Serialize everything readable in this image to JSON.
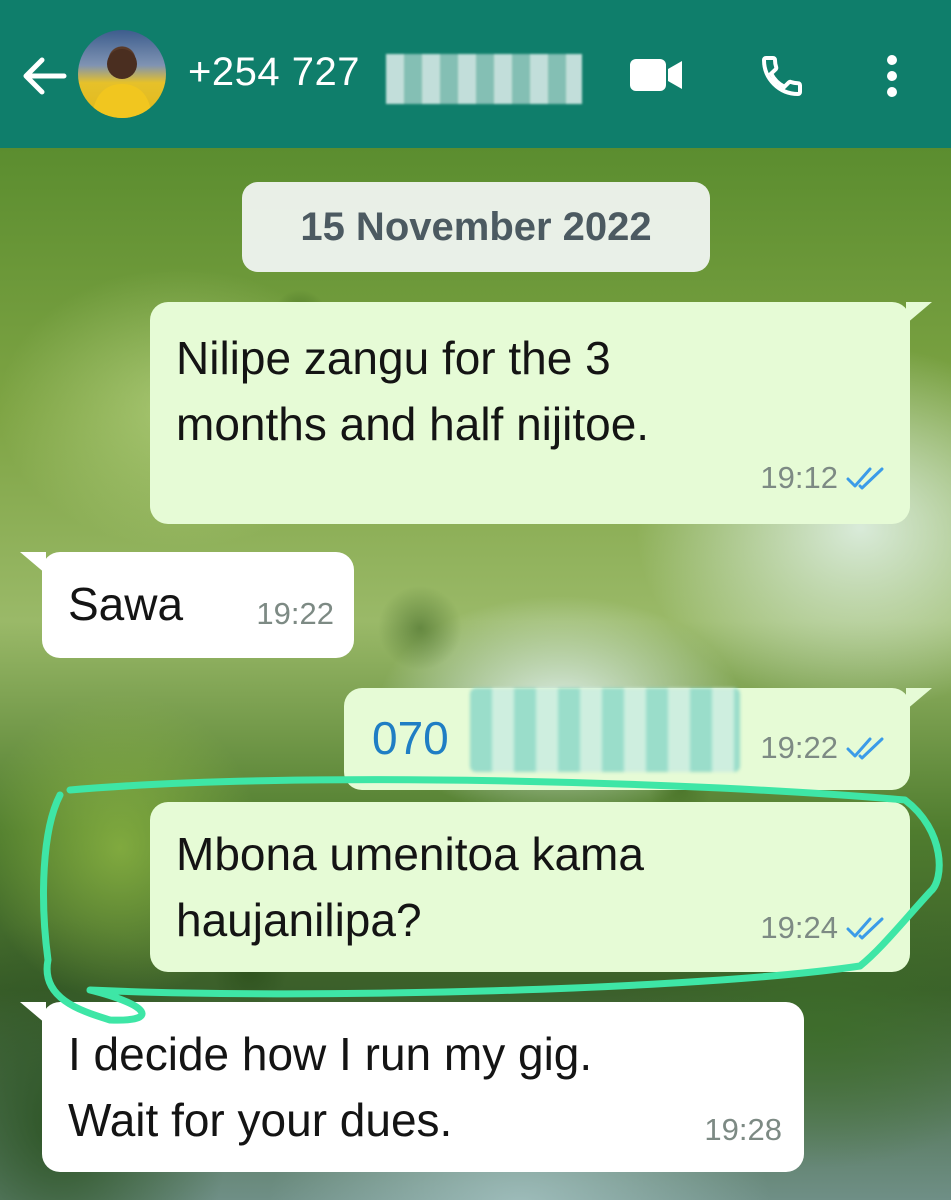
{
  "header": {
    "contact_name": "+254 727",
    "back_icon": "arrow-left-icon",
    "avatar_icon": "avatar",
    "video_icon": "video-camera-icon",
    "call_icon": "phone-icon",
    "menu_icon": "more-vertical-icon",
    "background": "#0f7e6b"
  },
  "chat": {
    "date": "15 November 2022",
    "messages": [
      {
        "direction": "outgoing",
        "lines": [
          "Nilipe zangu for the 3",
          "months and half nijitoe."
        ],
        "time": "19:12",
        "status": "read"
      },
      {
        "direction": "incoming",
        "lines": [
          "Sawa"
        ],
        "time": "19:22"
      },
      {
        "direction": "outgoing",
        "lines": [
          "070"
        ],
        "time": "19:22",
        "status": "read",
        "link": true
      },
      {
        "direction": "outgoing",
        "lines": [
          "Mbona umenitoa kama",
          "haujanilipa?"
        ],
        "time": "19:24",
        "status": "read",
        "highlighted": true
      },
      {
        "direction": "incoming",
        "lines": [
          "I decide how I run my gig.",
          "Wait for your dues."
        ],
        "time": "19:28"
      }
    ]
  },
  "colors": {
    "outgoing_bubble": "#e6fbd6",
    "incoming_bubble": "#ffffff",
    "read_tick": "#3b9be8",
    "highlight_stroke": "#3ee6a6"
  }
}
